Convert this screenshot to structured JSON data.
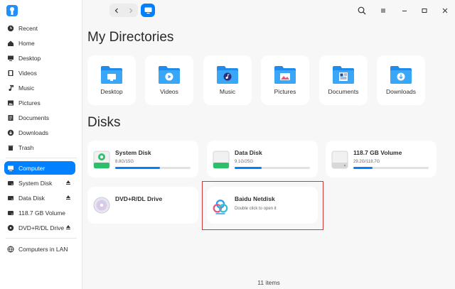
{
  "sidebar": {
    "items": [
      {
        "label": "Recent",
        "icon": "clock-icon"
      },
      {
        "label": "Home",
        "icon": "home-icon"
      },
      {
        "label": "Desktop",
        "icon": "desktop-icon"
      },
      {
        "label": "Videos",
        "icon": "film-icon"
      },
      {
        "label": "Music",
        "icon": "music-note-icon"
      },
      {
        "label": "Pictures",
        "icon": "picture-icon"
      },
      {
        "label": "Documents",
        "icon": "document-icon"
      },
      {
        "label": "Downloads",
        "icon": "download-icon"
      },
      {
        "label": "Trash",
        "icon": "trash-icon"
      }
    ],
    "computer": {
      "label": "Computer",
      "icon": "computer-icon"
    },
    "disks": [
      {
        "label": "System Disk",
        "icon": "disk-icon",
        "eject": true
      },
      {
        "label": "Data Disk",
        "icon": "disk-icon",
        "eject": true
      },
      {
        "label": "118.7 GB Volume",
        "icon": "disk-icon",
        "eject": false
      },
      {
        "label": "DVD+R/DL Drive",
        "icon": "optical-disc-icon",
        "eject": true
      }
    ],
    "lan": {
      "label": "Computers in LAN",
      "icon": "network-icon"
    }
  },
  "main": {
    "dirs_title": "My Directories",
    "dirs": [
      {
        "label": "Desktop",
        "icon": "desktop-folder-icon"
      },
      {
        "label": "Videos",
        "icon": "videos-folder-icon"
      },
      {
        "label": "Music",
        "icon": "music-folder-icon"
      },
      {
        "label": "Pictures",
        "icon": "pictures-folder-icon"
      },
      {
        "label": "Documents",
        "icon": "documents-folder-icon"
      },
      {
        "label": "Downloads",
        "icon": "downloads-folder-icon"
      }
    ],
    "disks_title": "Disks",
    "disks": [
      {
        "name": "System Disk",
        "usage": "8.8G/15G",
        "fill": 0.59
      },
      {
        "name": "Data Disk",
        "usage": "9.1G/25G",
        "fill": 0.36
      },
      {
        "name": "118.7 GB Volume",
        "usage": "29.2G/118.7G",
        "fill": 0.25
      }
    ],
    "dvd": {
      "name": "DVD+R/DL Drive"
    },
    "netdisk": {
      "name": "Baidu Netdisk",
      "sub": "Double click to open it"
    }
  },
  "status": {
    "text": "11 items"
  },
  "colors": {
    "accent": "#0081ff",
    "folder": "#2a9bf3",
    "highlight": "#d23a3a",
    "disk_green": "#2dbf6c"
  }
}
